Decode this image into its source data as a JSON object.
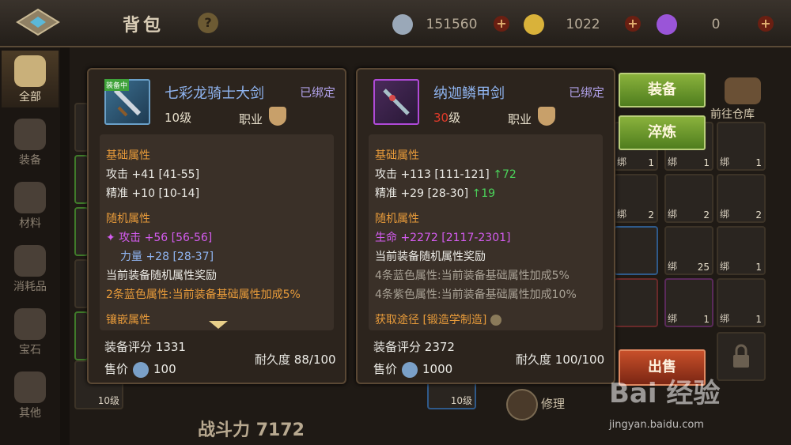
{
  "header": {
    "title": "背包",
    "help": "?"
  },
  "currency": [
    {
      "name": "silver",
      "value": "151560",
      "color": "#9aa8b8"
    },
    {
      "name": "gold",
      "value": "1022",
      "color": "#d9b23a"
    },
    {
      "name": "gem",
      "value": "0",
      "color": "#9a55d8"
    }
  ],
  "sidebar": {
    "items": [
      {
        "label": "全部",
        "icon": "armor-icon"
      },
      {
        "label": "装备",
        "icon": "armor-icon"
      },
      {
        "label": "材料",
        "icon": "material-icon"
      },
      {
        "label": "消耗品",
        "icon": "consumable-icon"
      },
      {
        "label": "宝石",
        "icon": "gem-icon"
      },
      {
        "label": "其他",
        "icon": "other-icon"
      }
    ]
  },
  "left_item": {
    "name": "七彩龙骑士大剑",
    "bound": "已绑定",
    "level": "10级",
    "job": "职业",
    "equipped_tag": "装备中",
    "basic_title": "基础属性",
    "basic": [
      "攻击 +41 [41-55]",
      "精准 +10 [10-14]"
    ],
    "random_title": "随机属性",
    "random": [
      "✦ 攻击 +56 [56-56]",
      "力量 +28 [28-37]"
    ],
    "bonus": "当前装备随机属性奖励",
    "bonus_line": "2条蓝色属性:当前装备基础属性加成5%",
    "inlay_title": "镶嵌属性",
    "score_label": "装备评分",
    "score": "1331",
    "price_label": "售价",
    "price": "100",
    "durability_label": "耐久度",
    "durability": "88/100"
  },
  "right_item": {
    "name": "纳迦鳞甲剑",
    "bound": "已绑定",
    "level_num": "30",
    "level_unit": "级",
    "job": "职业",
    "basic_title": "基础属性",
    "basic": [
      {
        "text": "攻击 +113 [111-121]",
        "up": "↑72"
      },
      {
        "text": "精准 +29 [28-30]",
        "up": "↑19"
      }
    ],
    "random_title": "随机属性",
    "random": [
      "生命 +2272 [2117-2301]"
    ],
    "bonus": "当前装备随机属性奖励",
    "bonus_lines": [
      "4条蓝色属性:当前装备基础属性加成5%",
      "4条紫色属性:当前装备基础属性加成10%"
    ],
    "source": "获取途径 [锻造学制造]",
    "score_label": "装备评分",
    "score": "2372",
    "price_label": "售价",
    "price": "1000",
    "durability_label": "耐久度",
    "durability": "100/100"
  },
  "buttons": {
    "equip": "装备",
    "refine": "淬炼",
    "sell": "出售",
    "repair": "修理",
    "warehouse": "前往仓库"
  },
  "slot_labels": {
    "bound": "绑",
    "lv10": "10级",
    "count25": "25",
    "c1": "1",
    "c2": "2"
  },
  "power": {
    "label": "战斗力",
    "value": "7172"
  },
  "watermark": {
    "logo": "Bai 经验",
    "url": "jingyan.baidu.com"
  }
}
